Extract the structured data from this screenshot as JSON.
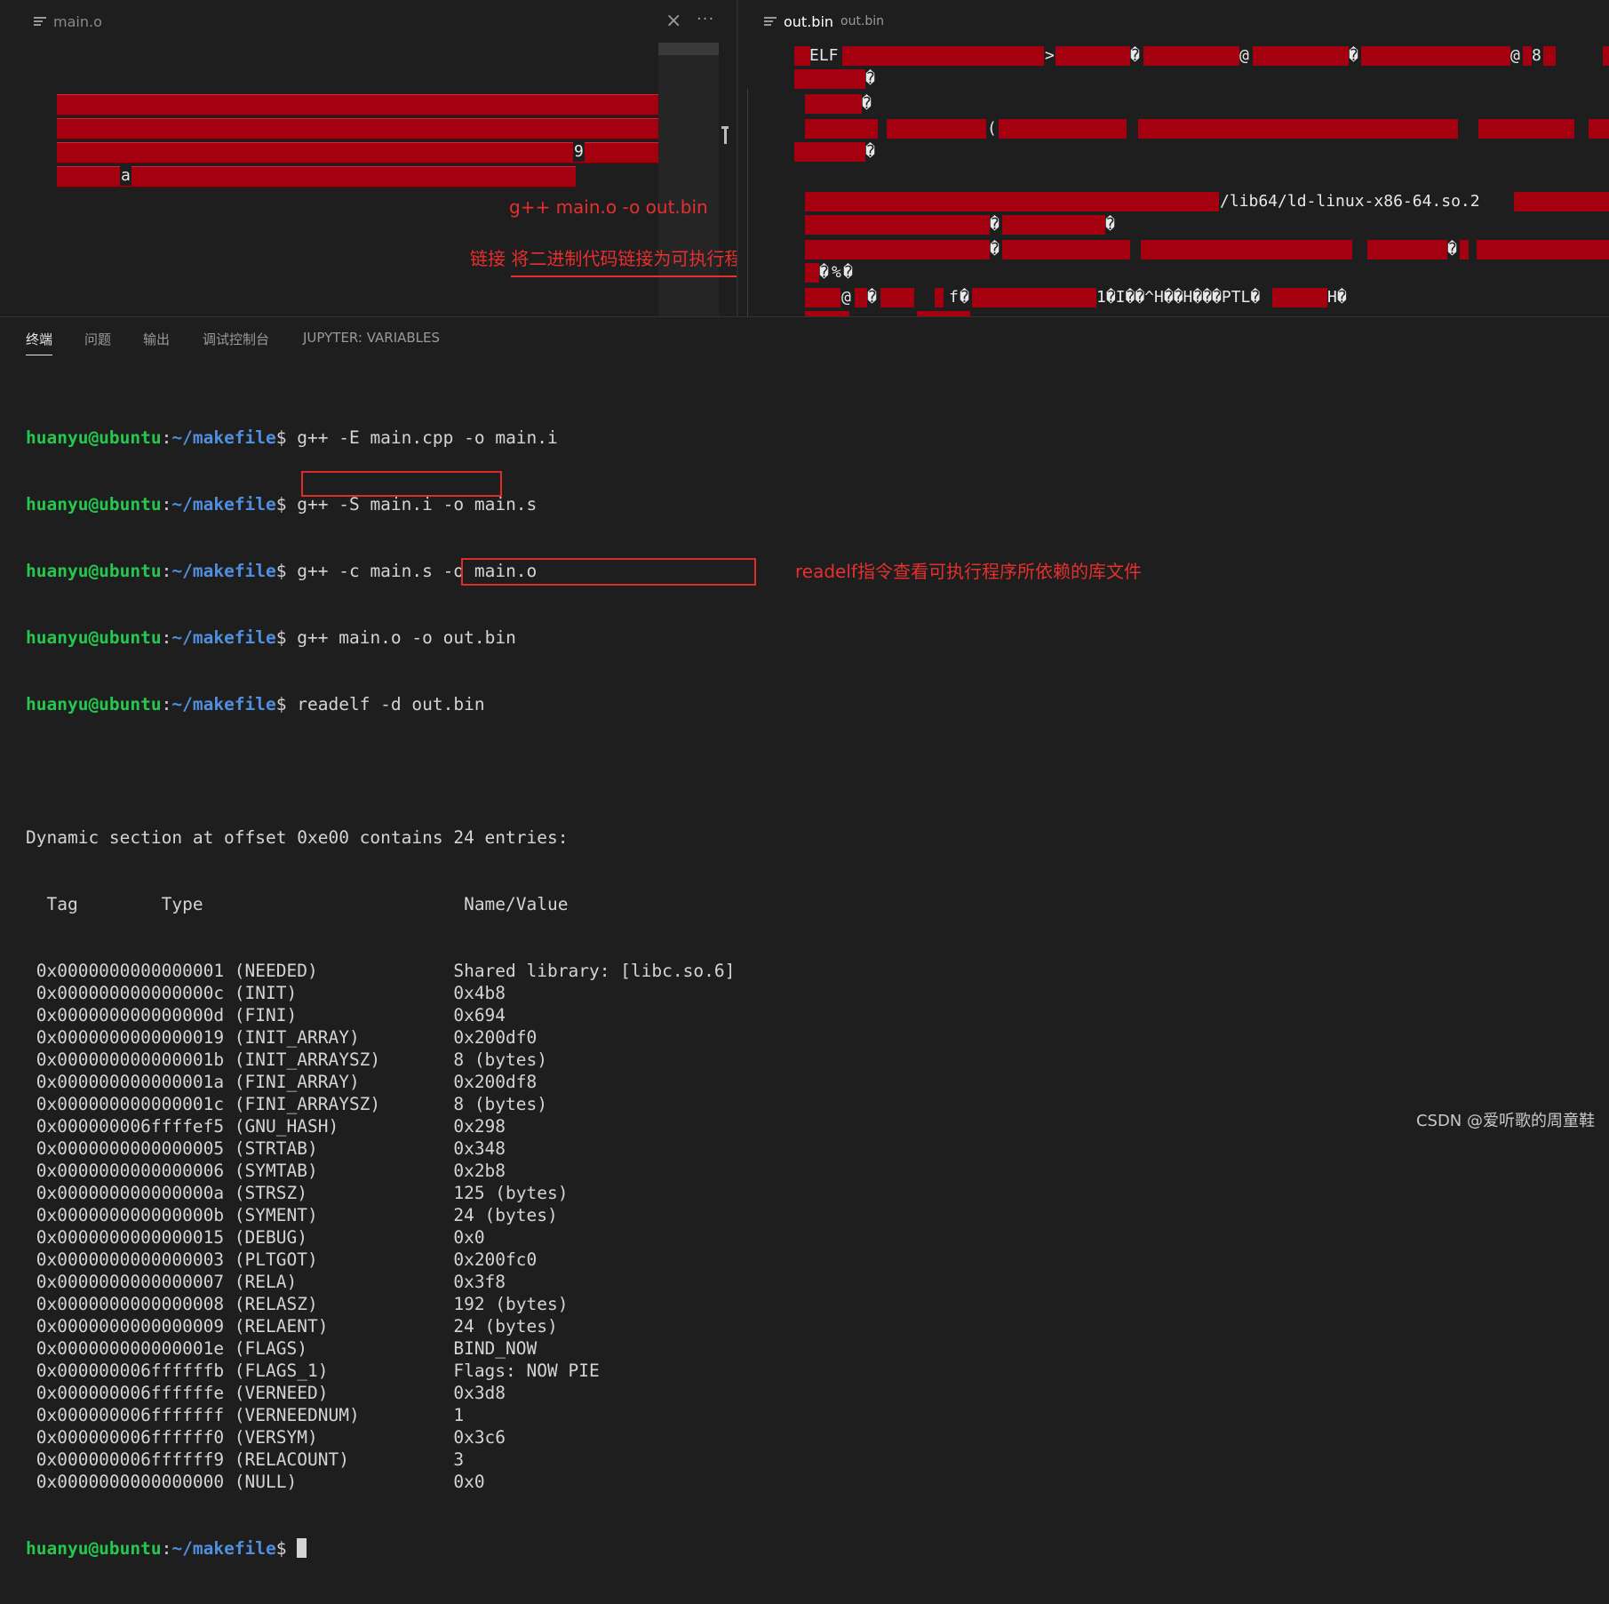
{
  "editor": {
    "left_tab": {
      "title": "main.o"
    },
    "right_tab": {
      "title": "out.bin",
      "description": "out.bin"
    },
    "left_binary": {
      "char_9": "9",
      "char_a": "a"
    },
    "right_binary": {
      "line1": "ELF",
      "gt": ">",
      "at1": "@",
      "at2": "@",
      "eight": "8",
      "paren": "(",
      "ld_path": "/lib64/ld-linux-x86-64.so.2",
      "line_pct": "%",
      "line_at_pct": "@",
      "f_char": "f",
      "tail": "1�I��^H��H���PTL�",
      "h_end": "H�",
      "replacement": "�"
    },
    "annotations": {
      "command": "g++ main.o -o out.bin",
      "description": "链接 将二进制代码链接为可执行程序"
    }
  },
  "panel": {
    "tabs": [
      {
        "label": "终端",
        "active": true
      },
      {
        "label": "问题",
        "active": false
      },
      {
        "label": "输出",
        "active": false
      },
      {
        "label": "调试控制台",
        "active": false
      },
      {
        "label": "JUPYTER: VARIABLES",
        "active": false
      }
    ]
  },
  "terminal": {
    "prompt_user": "huanyu@ubuntu",
    "prompt_sep": ":",
    "prompt_dir": "~/makefile",
    "prompt_sym": "$ ",
    "commands": [
      "g++ -E main.cpp -o main.i",
      "g++ -S main.i -o main.s",
      "g++ -c main.s -o main.o",
      "g++ main.o -o out.bin",
      "readelf -d out.bin"
    ],
    "summary": "Dynamic section at offset 0xe00 contains 24 entries:",
    "header": "  Tag        Type                         Name/Value",
    "entries": [
      " 0x0000000000000001 (NEEDED)             Shared library: [libc.so.6]",
      " 0x000000000000000c (INIT)               0x4b8",
      " 0x000000000000000d (FINI)               0x694",
      " 0x0000000000000019 (INIT_ARRAY)         0x200df0",
      " 0x000000000000001b (INIT_ARRAYSZ)       8 (bytes)",
      " 0x000000000000001a (FINI_ARRAY)         0x200df8",
      " 0x000000000000001c (FINI_ARRAYSZ)       8 (bytes)",
      " 0x000000006ffffef5 (GNU_HASH)           0x298",
      " 0x0000000000000005 (STRTAB)             0x348",
      " 0x0000000000000006 (SYMTAB)             0x2b8",
      " 0x000000000000000a (STRSZ)              125 (bytes)",
      " 0x000000000000000b (SYMENT)             24 (bytes)",
      " 0x0000000000000015 (DEBUG)              0x0",
      " 0x0000000000000003 (PLTGOT)             0x200fc0",
      " 0x0000000000000007 (RELA)               0x3f8",
      " 0x0000000000000008 (RELASZ)             192 (bytes)",
      " 0x0000000000000009 (RELAENT)            24 (bytes)",
      " 0x000000000000001e (FLAGS)              BIND_NOW",
      " 0x000000006ffffffb (FLAGS_1)            Flags: NOW PIE",
      " 0x000000006ffffffe (VERNEED)            0x3d8",
      " 0x000000006fffffff (VERNEEDNUM)         1",
      " 0x000000006ffffff0 (VERSYM)             0x3c6",
      " 0x000000006ffffff9 (RELACOUNT)          3",
      " 0x0000000000000000 (NULL)               0x0"
    ],
    "annotation": "readelf指令查看可执行程序所依赖的库文件"
  },
  "watermark": "CSDN @爱听歌的周童鞋",
  "colors": {
    "background": "#1e1e1e",
    "prompt_user": "#26c74f",
    "prompt_dir": "#4f8fdd",
    "annotation": "#e62f2f",
    "binary_highlight": "#a4000f"
  }
}
